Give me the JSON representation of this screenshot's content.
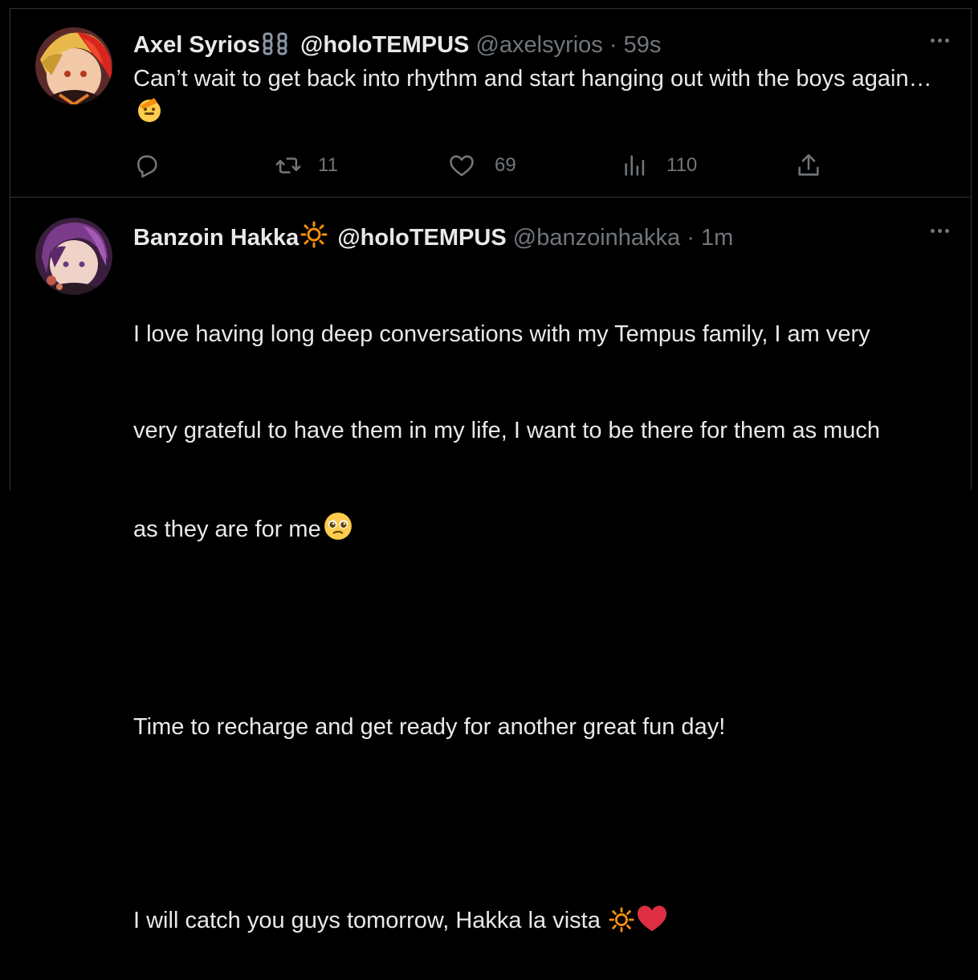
{
  "tweets": [
    {
      "name": "Axel Syrios",
      "list_handle": "@holoTEMPUS",
      "handle": "@axelsyrios",
      "separator": "·",
      "time": "59s",
      "text": "Can’t wait to get back into rhythm and start hanging out with the boys again…",
      "badge_icon": "chain-link-icon",
      "text_emoji": "saluting-face-emoji",
      "actions": {
        "reply_count": "",
        "retweet_count": "11",
        "like_count": "69",
        "view_count": "110"
      }
    },
    {
      "name": "Banzoin Hakka",
      "list_handle": "@holoTEMPUS",
      "handle": "@banzoinhakka",
      "separator": "·",
      "time": "1m",
      "badge_icon": "sun-icon",
      "text_lines": [
        "I love having long deep conversations with my Tempus family, I am very",
        "very grateful to have them in my life, I want to be there for them as much",
        "as they are for me"
      ],
      "text_line_4": "Time to recharge and get ready for another great fun day!",
      "text_line_5": "I will catch you guys tomorrow, Hakka la vista",
      "emojis": [
        "pleading-face-emoji",
        "sun-emoji",
        "red-heart-emoji"
      ]
    }
  ],
  "colors": {
    "background": "#000000",
    "text": "#e7e9ea",
    "secondary": "#71767b",
    "border": "#2f3336",
    "heart": "#f91880",
    "sun": "#f4900c"
  }
}
